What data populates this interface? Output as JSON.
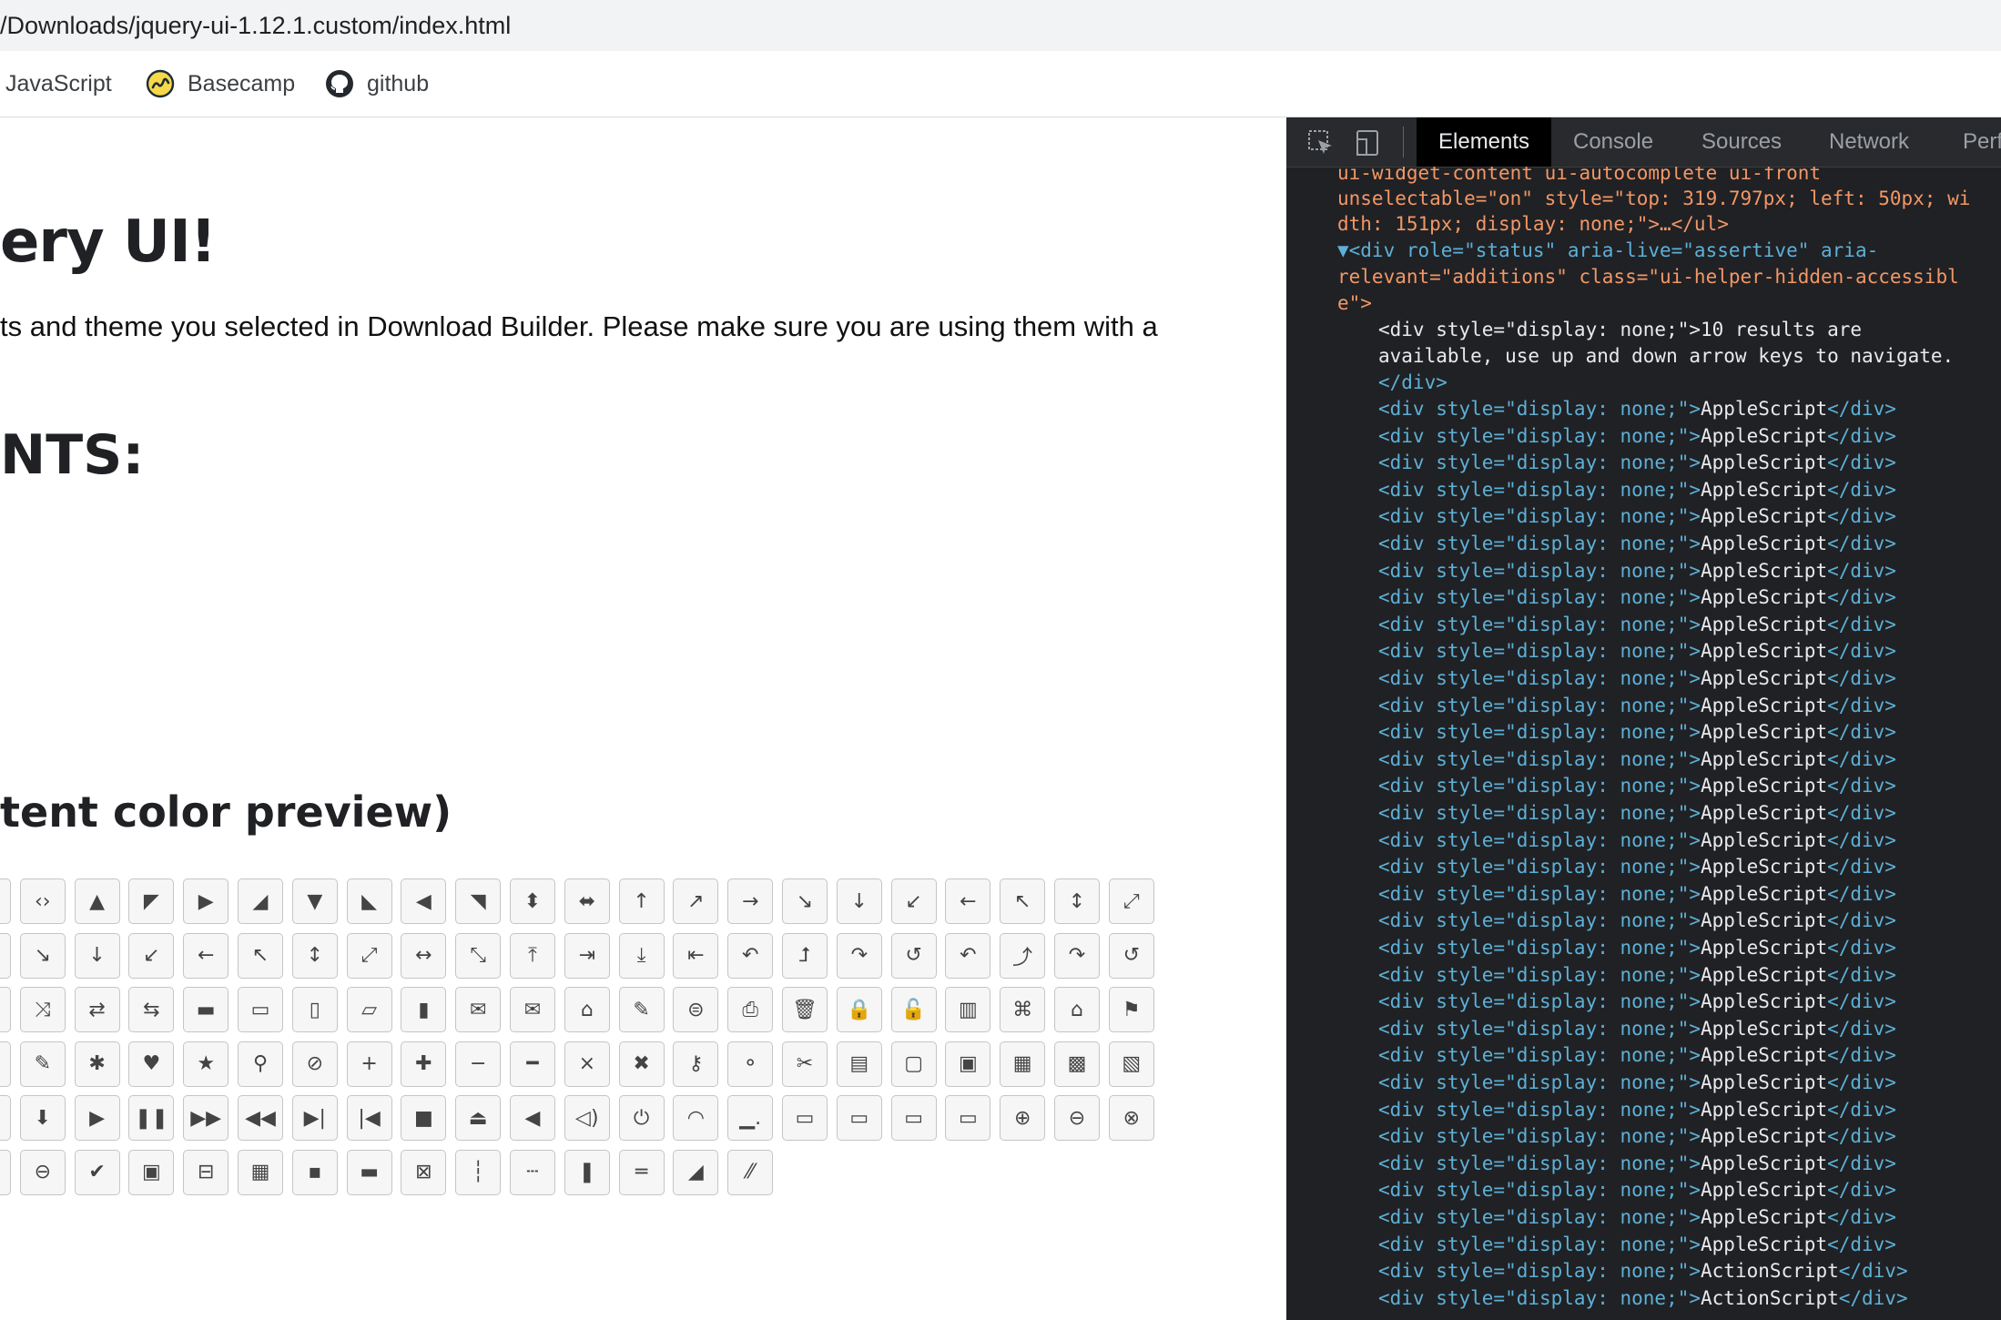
{
  "browser": {
    "url": "/Downloads/jquery-ui-1.12.1.custom/index.html",
    "bookmarks": [
      {
        "label": "JavaScript",
        "icon": "javascript-bookmark-icon"
      },
      {
        "label": "Basecamp",
        "icon": "basecamp-icon"
      },
      {
        "label": "github",
        "icon": "github-icon"
      }
    ]
  },
  "page": {
    "heading": "ery UI!",
    "intro": "ts and theme you selected in Download Builder. Please make sure you are using them with a",
    "components_heading": "NTS:",
    "icons_heading": "tent color preview)",
    "icon_rows": [
      [
        "↕",
        "‹›",
        "▲",
        "◤",
        "▶",
        "◢",
        "▼",
        "◣",
        "◀",
        "◥",
        "⬍",
        "⬌",
        "↑",
        "↗",
        "→",
        "↘",
        "↓",
        "↙",
        "←",
        "↖",
        "↕",
        "⤢"
      ],
      [
        "→",
        "↘",
        "↓",
        "↙",
        "←",
        "↖",
        "↕",
        "⤢",
        "↔",
        "⤡",
        "⤒",
        "⇥",
        "⤓",
        "⇤",
        "↶",
        "⮥",
        "↷",
        "↺",
        "↶",
        "⤴",
        "↷",
        "↺"
      ],
      [
        "↻",
        "⤨",
        "⇄",
        "⇆",
        "▬",
        "▭",
        "▯",
        "▱",
        "▮",
        "✉",
        "✉",
        "⌂",
        "✎",
        "⊜",
        "⎙",
        "🗑",
        "🔒",
        "🔓",
        "▥",
        "⌘",
        "⌂",
        "⚑"
      ],
      [
        "⌕",
        "✎",
        "✱",
        "♥",
        "★",
        "⚲",
        "⊘",
        "+",
        "✚",
        "−",
        "━",
        "×",
        "✖",
        "⚷",
        "⚬",
        "✂",
        "▤",
        "▢",
        "▣",
        "▦",
        "▩",
        "▧"
      ],
      [
        "⇥",
        "⬇",
        "▶",
        "❚❚",
        "▶▶",
        "◀◀",
        "▶|",
        "|◀",
        "■",
        "⏏",
        "◀",
        "◁)",
        "⏻",
        "◠",
        "▁.",
        "▭",
        "▭",
        "▭",
        "▭",
        "⊕",
        "⊖",
        "⊗"
      ],
      [
        "⊕",
        "⊖",
        "✔",
        "▣",
        "⊟",
        "▦",
        "▪",
        "▬",
        "⊠",
        "┆",
        "┄",
        "❚",
        "═",
        "◢",
        "⁄⁄"
      ]
    ]
  },
  "devtools": {
    "tabs": [
      "Elements",
      "Console",
      "Sources",
      "Network",
      "Perfor"
    ],
    "active_tab": "Elements",
    "head_lines": [
      {
        "text": "ui-widget-content ui-autocomplete ui-front"
      },
      {
        "text": "unselectable=\"on\" style=\"top: 319.797px; left: 50px; wi"
      },
      {
        "text": "dth: 151px; display: none;\">…</ul>"
      },
      {
        "text": "▼<div role=\"status\" aria-live=\"assertive\" aria-"
      },
      {
        "text": "relevant=\"additions\" class=\"ui-helper-hidden-accessibl"
      },
      {
        "text": "e\">"
      },
      {
        "text": "<div style=\"display: none;\">10 results are"
      },
      {
        "text": "available, use up and down arrow keys to navigate."
      },
      {
        "text": "</div>"
      }
    ],
    "div_rows": [
      "AppleScript",
      "AppleScript",
      "AppleScript",
      "AppleScript",
      "AppleScript",
      "AppleScript",
      "AppleScript",
      "AppleScript",
      "AppleScript",
      "AppleScript",
      "AppleScript",
      "AppleScript",
      "AppleScript",
      "AppleScript",
      "AppleScript",
      "AppleScript",
      "AppleScript",
      "AppleScript",
      "AppleScript",
      "AppleScript",
      "AppleScript",
      "AppleScript",
      "AppleScript",
      "AppleScript",
      "AppleScript",
      "AppleScript",
      "AppleScript",
      "AppleScript",
      "AppleScript",
      "AppleScript",
      "AppleScript",
      "AppleScript",
      "ActionScript",
      "ActionScript"
    ],
    "div_open": "<div style=\"display: none;\">",
    "div_close": "</div>"
  }
}
